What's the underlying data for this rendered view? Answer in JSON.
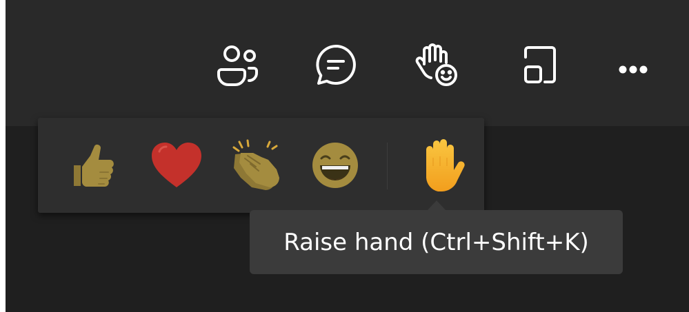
{
  "toolbar": {
    "buttons": [
      {
        "name": "people",
        "icon": "people-icon"
      },
      {
        "name": "chat",
        "icon": "chat-icon"
      },
      {
        "name": "reactions",
        "icon": "hand-smiley-icon"
      },
      {
        "name": "rooms",
        "icon": "rooms-icon"
      },
      {
        "name": "more",
        "icon": "ellipsis-icon"
      }
    ],
    "icon_color": "#ffffff"
  },
  "reactions": {
    "items": [
      {
        "name": "like",
        "icon": "thumbs-up-icon"
      },
      {
        "name": "heart",
        "icon": "heart-icon"
      },
      {
        "name": "applause",
        "icon": "clapping-hands-icon"
      },
      {
        "name": "laugh",
        "icon": "laughing-face-icon"
      },
      {
        "name": "raise-hand",
        "icon": "raised-hand-icon"
      }
    ],
    "colors": {
      "skin_tone": "#a48c3f",
      "heart": "#c4312b",
      "raise_hand": "#f6b22e"
    }
  },
  "tooltip": {
    "text": "Raise hand (Ctrl+Shift+K)"
  }
}
